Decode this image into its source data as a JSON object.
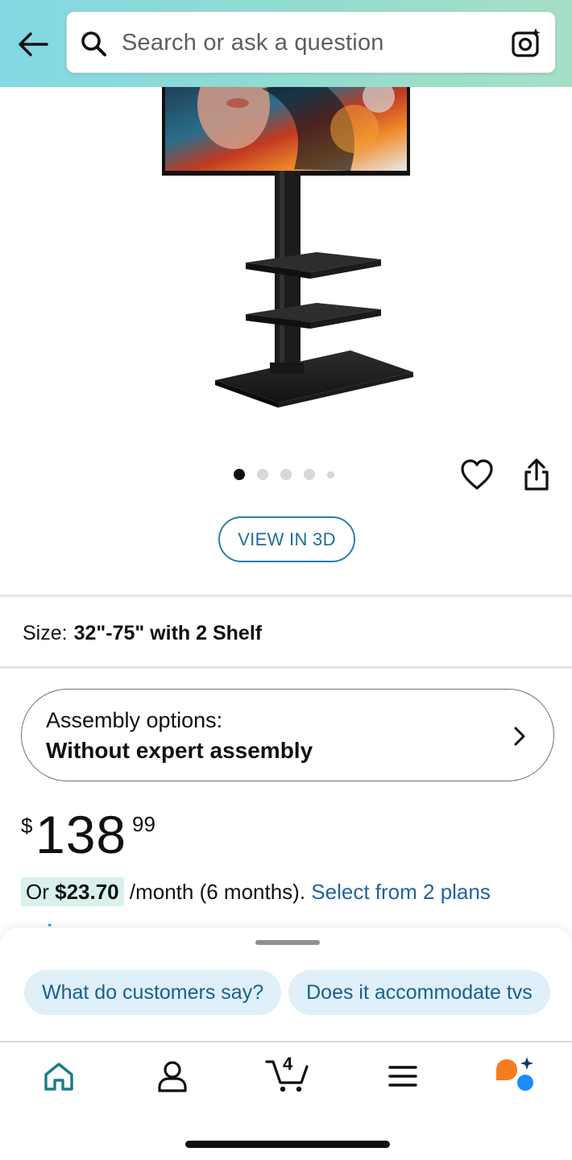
{
  "header": {
    "back_icon": "arrow-left-icon",
    "search": {
      "placeholder": "Search or ask a question",
      "icon": "search-icon",
      "camera_icon": "camera-lens-icon"
    }
  },
  "product": {
    "image_alt": "TV floor stand with 2 shelves and mounted TV",
    "carousel": {
      "count": 5,
      "active_index": 0
    },
    "wishlist_icon": "heart-outline-icon",
    "share_icon": "share-icon",
    "view3d_label": "VIEW IN 3D",
    "size_label": "Size:",
    "size_value": "32\"-75\" with 2 Shelf",
    "assembly": {
      "title": "Assembly options:",
      "value": "Without expert assembly",
      "chevron_icon": "chevron-right-icon"
    },
    "price": {
      "symbol": "$",
      "whole": "138",
      "fraction": "99"
    },
    "monthly": {
      "prefix": "Or ",
      "amount": "$23.70",
      "suffix": " /month (6 months). ",
      "link": "Select from 2 plans"
    },
    "prime_badge": "prime"
  },
  "sheet": {
    "chips": [
      "What do customers say?",
      "Does it accommodate tvs"
    ]
  },
  "nav": {
    "home_icon": "home-icon",
    "account_icon": "account-icon",
    "cart_icon": "cart-icon",
    "cart_count": "4",
    "menu_icon": "hamburger-menu-icon",
    "assistant_icon": "assistant-icon"
  },
  "colors": {
    "header_gradient_start": "#82d8e3",
    "header_gradient_end": "#a5e0c6",
    "link": "#2162a1",
    "view3d_border": "#2b7fa8",
    "chip_bg": "#dff0fb",
    "home_active": "#1b7a8c",
    "assistant_orange": "#f57c1f",
    "assistant_blue": "#1a8cff"
  }
}
